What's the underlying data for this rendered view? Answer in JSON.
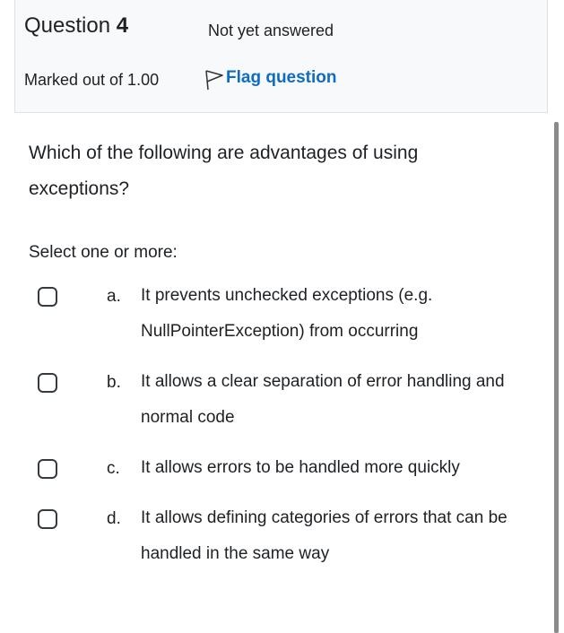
{
  "question": {
    "label": "Question",
    "number": "4",
    "state": "Not yet answered",
    "grade": "Marked out of 1.00",
    "flag_label": "Flag question"
  },
  "text": "Which of the following are advantages of using exceptions?",
  "prompt": "Select one or more:",
  "options": [
    {
      "letter": "a.",
      "text": "It prevents unchecked exceptions (e.g. NullPointerException) from occurring",
      "checked": false
    },
    {
      "letter": "b.",
      "text": "It allows a clear separation of error handling and normal code",
      "checked": false
    },
    {
      "letter": "c.",
      "text": "It allows errors to be handled more quickly",
      "checked": false
    },
    {
      "letter": "d.",
      "text": "It allows defining categories of errors that can be handled in the same way",
      "checked": false
    }
  ],
  "colors": {
    "link": "#0f6cbf",
    "info_bg": "#f8f9fa",
    "info_border": "#dee2e6",
    "text": "#1d2125"
  },
  "icons": {
    "flag": "flag-outline-icon"
  }
}
